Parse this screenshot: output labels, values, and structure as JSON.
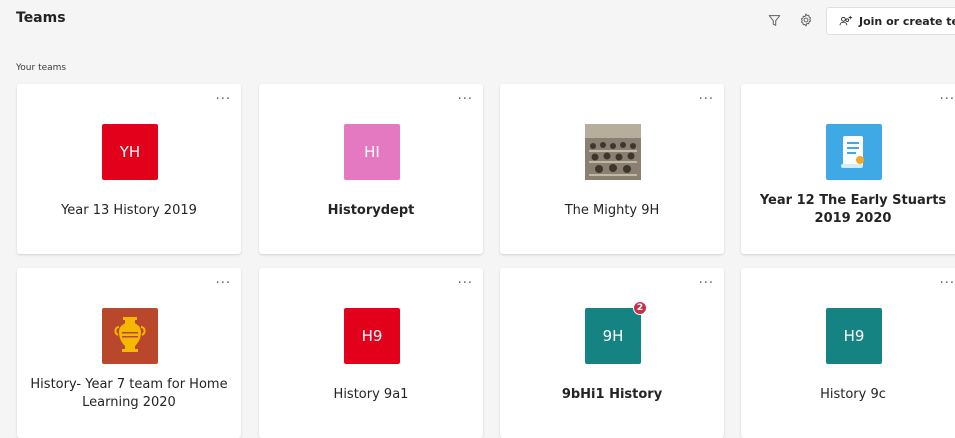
{
  "header": {
    "title": "Teams",
    "join_label": "Join or create team"
  },
  "section_label": "Your teams",
  "more_label": "...",
  "colors": {
    "red": "#e3001b",
    "pink": "#e579c1",
    "teal": "#168383",
    "amphora_bg": "#b9472b",
    "doc_bg": "#3fa9e6"
  },
  "teams": [
    {
      "name": "Year 13 History 2019",
      "avatar_text": "YH",
      "avatar_color": "#e3001b",
      "bold": false
    },
    {
      "name": "Historydept",
      "avatar_text": "HI",
      "avatar_color": "#e579c1",
      "bold": true
    },
    {
      "name": "The Mighty 9H",
      "avatar_image": "classroom-photo",
      "bold": false
    },
    {
      "name": "Year 12 The Early Stuarts 2019 2020",
      "avatar_image": "document-icon",
      "bold": true
    },
    {
      "name": "History- Year 7 team for Home Learning 2020",
      "avatar_image": "amphora-icon",
      "bold": false
    },
    {
      "name": "History 9a1",
      "avatar_text": "H9",
      "avatar_color": "#e3001b",
      "bold": false
    },
    {
      "name": "9bHi1 History",
      "avatar_text": "9H",
      "avatar_color": "#168383",
      "bold": true,
      "badge": "2"
    },
    {
      "name": "History 9c",
      "avatar_text": "H9",
      "avatar_color": "#168383",
      "bold": false
    }
  ]
}
